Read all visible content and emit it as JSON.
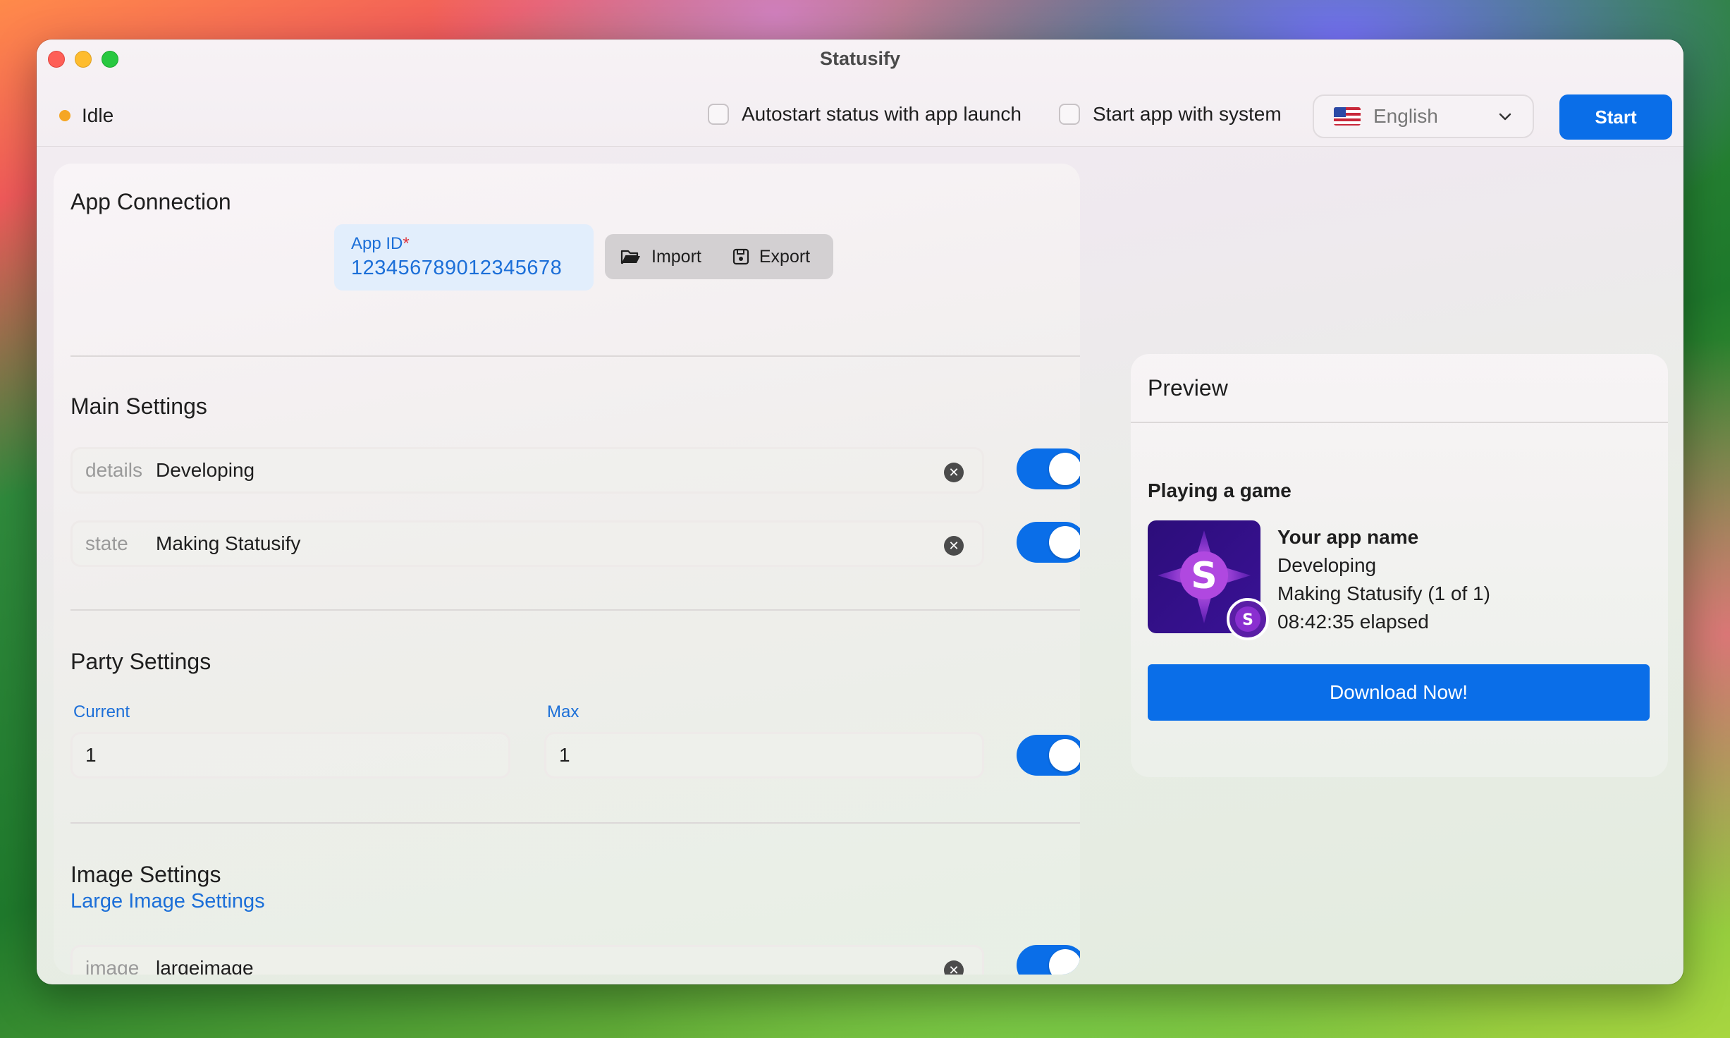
{
  "window": {
    "title": "Statusify"
  },
  "toolbar": {
    "status_text": "Idle",
    "autostart_label": "Autostart status with app launch",
    "start_with_system_label": "Start app with system",
    "language": "English",
    "start_label": "Start"
  },
  "app_connection": {
    "title": "App Connection",
    "app_id_label": "App ID",
    "required_mark": "*",
    "app_id_value": "123456789012345678",
    "import_label": "Import",
    "export_label": "Export"
  },
  "main_settings": {
    "title": "Main Settings",
    "fields": [
      {
        "key": "details",
        "value": "Developing",
        "enabled": true
      },
      {
        "key": "state",
        "value": "Making Statusify",
        "enabled": true
      }
    ]
  },
  "party_settings": {
    "title": "Party Settings",
    "current_label": "Current",
    "current_value": "1",
    "max_label": "Max",
    "max_value": "1",
    "enabled": true
  },
  "image_settings": {
    "title": "Image Settings",
    "large_link": "Large Image Settings",
    "field": {
      "key": "image",
      "value": "largeimage",
      "enabled": true
    }
  },
  "preview": {
    "title": "Preview",
    "activity": "Playing a game",
    "app_name": "Your app name",
    "details": "Developing",
    "state": "Making Statusify (1 of 1)",
    "elapsed": "08:42:35 elapsed",
    "icon_letter": "S",
    "button_label": "Download Now!"
  },
  "colors": {
    "accent": "#0a6ee8",
    "status_idle": "#f5a623",
    "link": "#1c6fd8"
  }
}
